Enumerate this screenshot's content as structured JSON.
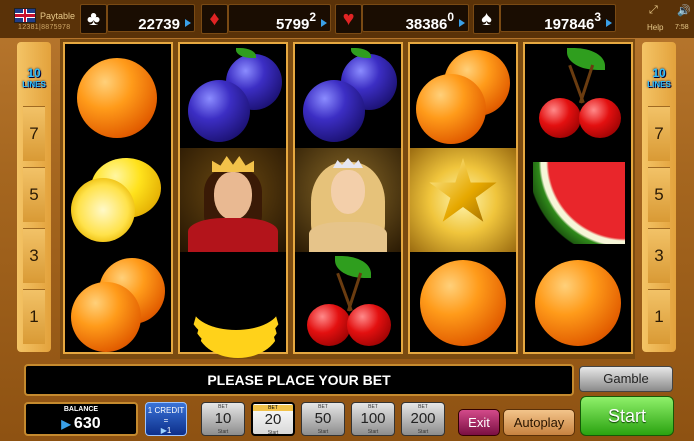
{
  "header": {
    "paytable_label": "Paytable",
    "ticket_id": "12381|8875978",
    "help_label": "Help",
    "clock": "7:58"
  },
  "jackpots": [
    {
      "suit": "clubs",
      "icon": "♣",
      "value": "22739",
      "sup": ""
    },
    {
      "suit": "diamonds",
      "icon": "♦",
      "value": "5799",
      "sup": "2"
    },
    {
      "suit": "hearts",
      "icon": "♥",
      "value": "38386",
      "sup": "0"
    },
    {
      "suit": "spades",
      "icon": "♠",
      "value": "197846",
      "sup": "3"
    }
  ],
  "lines": {
    "count": "10",
    "label": "LINES",
    "numbers": [
      "7",
      "5",
      "3",
      "1"
    ]
  },
  "reels": [
    [
      "orange",
      "lemon",
      "orange"
    ],
    [
      "plum",
      "king",
      "banana"
    ],
    [
      "plum",
      "queen",
      "cherry"
    ],
    [
      "orange",
      "star",
      "orange"
    ],
    [
      "cherry",
      "watermelon",
      "orange"
    ]
  ],
  "message": "PLEASE PLACE YOUR BET",
  "gamble_label": "Gamble",
  "balance": {
    "label": "BALANCE",
    "value": "630"
  },
  "credit": {
    "line1": "1 CREDIT",
    "line2": "=",
    "line3": "1"
  },
  "bets": [
    {
      "top": "BET",
      "value": "10",
      "bottom": "Start",
      "selected": false
    },
    {
      "top": "BET",
      "value": "20",
      "bottom": "Start",
      "selected": true
    },
    {
      "top": "BET",
      "value": "50",
      "bottom": "Start",
      "selected": false
    },
    {
      "top": "BET",
      "value": "100",
      "bottom": "Start",
      "selected": false
    },
    {
      "top": "BET",
      "value": "200",
      "bottom": "Start",
      "selected": false
    }
  ],
  "exit_label": "Exit",
  "autoplay_label": "Autoplay",
  "start_label": "Start",
  "colors": {
    "accent_blue": "#3aa0e8",
    "start_green": "#2aa310",
    "frame_gold": "#e6a840"
  }
}
